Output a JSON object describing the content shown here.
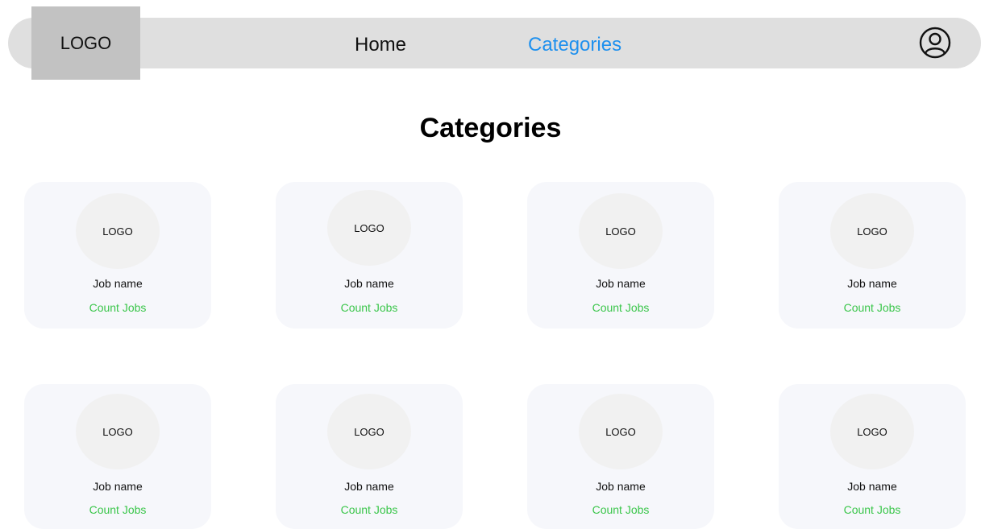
{
  "colors": {
    "accent": "#1e90ee",
    "count": "#3ac64a",
    "navbar_bg": "#dfdfdf",
    "logo_box_bg": "#c2c2c2",
    "card_bg": "#f6f7fb"
  },
  "header": {
    "logo_text": "LOGO",
    "nav": [
      {
        "label": "Home",
        "active": false
      },
      {
        "label": "Categories",
        "active": true
      }
    ],
    "profile_icon": "user-circle-icon"
  },
  "main": {
    "title": "Categories",
    "cards": [
      {
        "logo": "LOGO",
        "name": "Job name",
        "count": "Count Jobs"
      },
      {
        "logo": "LOGO",
        "name": "Job name",
        "count": "Count Jobs"
      },
      {
        "logo": "LOGO",
        "name": "Job name",
        "count": "Count Jobs"
      },
      {
        "logo": "LOGO",
        "name": "Job name",
        "count": "Count Jobs"
      },
      {
        "logo": "LOGO",
        "name": "Job name",
        "count": "Count Jobs"
      },
      {
        "logo": "LOGO",
        "name": "Job name",
        "count": "Count Jobs"
      },
      {
        "logo": "LOGO",
        "name": "Job name",
        "count": "Count Jobs"
      },
      {
        "logo": "LOGO",
        "name": "Job name",
        "count": "Count Jobs"
      }
    ]
  }
}
